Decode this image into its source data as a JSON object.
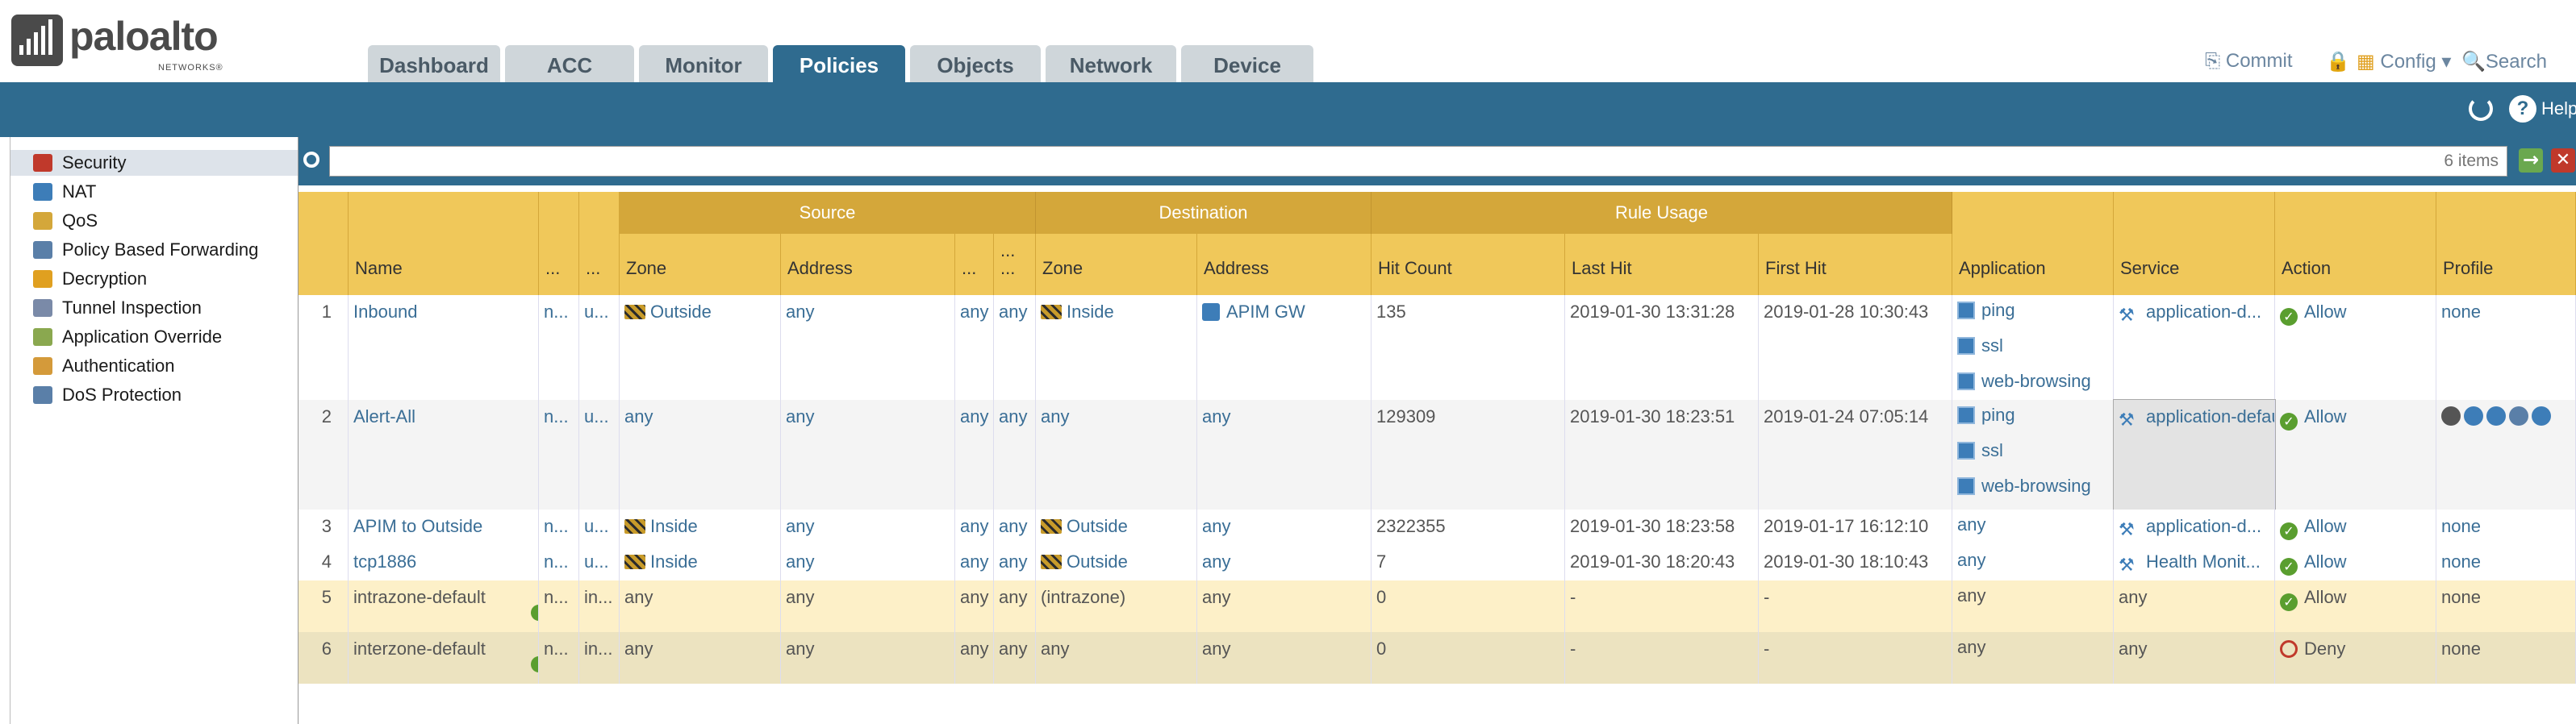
{
  "brand": {
    "name": "paloalto",
    "sub": "NETWORKS®"
  },
  "tabs": [
    "Dashboard",
    "ACC",
    "Monitor",
    "Policies",
    "Objects",
    "Network",
    "Device"
  ],
  "active_tab": "Policies",
  "toplinks": {
    "commit": "Commit",
    "config": "Config",
    "search": "Search"
  },
  "help": "Help",
  "sidebar": [
    "Security",
    "NAT",
    "QoS",
    "Policy Based Forwarding",
    "Decryption",
    "Tunnel Inspection",
    "Application Override",
    "Authentication",
    "DoS Protection"
  ],
  "sidebar_selected": "Security",
  "filter": {
    "count": "6 items"
  },
  "groups": [
    "Source",
    "Destination",
    "Rule Usage"
  ],
  "headers": [
    "Name",
    "...",
    "...",
    "Zone",
    "Address",
    "...",
    "...\n...",
    "Zone",
    "Address",
    "Hit Count",
    "Last Hit",
    "First Hit",
    "Application",
    "Service",
    "Action",
    "Profile"
  ],
  "rows": [
    {
      "num": "1",
      "name": "Inbound",
      "c1": "n...",
      "c2": "u...",
      "szone": "Outside",
      "saddr": "any",
      "a1": "any",
      "a2": "any",
      "dzone": "Inside",
      "daddr": "APIM GW",
      "hits": "135",
      "last": "2019-01-30 13:31:28",
      "first": "2019-01-28 10:30:43",
      "apps": [
        "ping",
        "ssl",
        "web-browsing"
      ],
      "service": "application-d...",
      "action": "Allow",
      "profile": "none"
    },
    {
      "num": "2",
      "name": "Alert-All",
      "c1": "n...",
      "c2": "u...",
      "szone": "any",
      "saddr": "any",
      "a1": "any",
      "a2": "any",
      "dzone": "any",
      "daddr": "any",
      "hits": "129309",
      "last": "2019-01-30 18:23:51",
      "first": "2019-01-24 07:05:14",
      "apps": [
        "ping",
        "ssl",
        "web-browsing"
      ],
      "service": "application-default",
      "action": "Allow",
      "profile": ""
    },
    {
      "num": "3",
      "name": "APIM to Outside",
      "c1": "n...",
      "c2": "u...",
      "szone": "Inside",
      "saddr": "any",
      "a1": "any",
      "a2": "any",
      "dzone": "Outside",
      "daddr": "any",
      "hits": "2322355",
      "last": "2019-01-30 18:23:58",
      "first": "2019-01-17 16:12:10",
      "apps": [
        "any"
      ],
      "service": "application-d...",
      "action": "Allow",
      "profile": "none"
    },
    {
      "num": "4",
      "name": "tcp1886",
      "c1": "n...",
      "c2": "u...",
      "szone": "Inside",
      "saddr": "any",
      "a1": "any",
      "a2": "any",
      "dzone": "Outside",
      "daddr": "any",
      "hits": "7",
      "last": "2019-01-30 18:20:43",
      "first": "2019-01-30 18:10:43",
      "apps": [
        "any"
      ],
      "service": "Health Monit...",
      "action": "Allow",
      "profile": "none"
    },
    {
      "num": "5",
      "name": "intrazone-default",
      "c1": "n...",
      "c2": "in...",
      "szone": "any",
      "saddr": "any",
      "a1": "any",
      "a2": "any",
      "dzone": "(intrazone)",
      "daddr": "any",
      "hits": "0",
      "last": "-",
      "first": "-",
      "apps": [
        "any"
      ],
      "service": "any",
      "action": "Allow",
      "profile": "none"
    },
    {
      "num": "6",
      "name": "interzone-default",
      "c1": "n...",
      "c2": "in...",
      "szone": "any",
      "saddr": "any",
      "a1": "any",
      "a2": "any",
      "dzone": "any",
      "daddr": "any",
      "hits": "0",
      "last": "-",
      "first": "-",
      "apps": [
        "any"
      ],
      "service": "any",
      "action": "Deny",
      "profile": "none"
    }
  ]
}
